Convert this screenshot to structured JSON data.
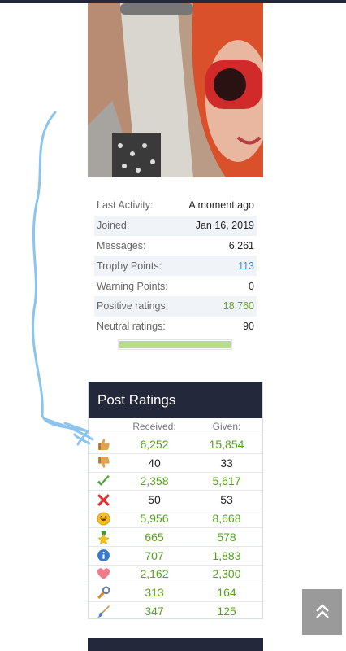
{
  "stats": [
    {
      "label": "Last Activity:",
      "value": "A moment ago",
      "style": "normal"
    },
    {
      "label": "Joined:",
      "value": "Jan 16, 2019",
      "style": "normal"
    },
    {
      "label": "Messages:",
      "value": "6,261",
      "style": "normal"
    },
    {
      "label": "Trophy Points:",
      "value": "113",
      "style": "blue"
    },
    {
      "label": "Warning Points:",
      "value": "0",
      "style": "normal"
    },
    {
      "label": "Positive ratings:",
      "value": "18,760",
      "style": "green"
    },
    {
      "label": "Neutral ratings:",
      "value": "90",
      "style": "normal"
    }
  ],
  "ratings": {
    "title": "Post Ratings",
    "received_label": "Received:",
    "given_label": "Given:",
    "rows": [
      {
        "icon": "like-icon",
        "received": "6,252",
        "given": "15,854",
        "tone": "green"
      },
      {
        "icon": "dislike-icon",
        "received": "40",
        "given": "33",
        "tone": "dark"
      },
      {
        "icon": "agree-icon",
        "received": "2,358",
        "given": "5,617",
        "tone": "green"
      },
      {
        "icon": "disagree-icon",
        "received": "50",
        "given": "53",
        "tone": "dark"
      },
      {
        "icon": "funny-icon",
        "received": "5,956",
        "given": "8,668",
        "tone": "green"
      },
      {
        "icon": "winner-icon",
        "received": "665",
        "given": "578",
        "tone": "green"
      },
      {
        "icon": "informative-icon",
        "received": "707",
        "given": "1,883",
        "tone": "green"
      },
      {
        "icon": "love-icon",
        "received": "2,162",
        "given": "2,300",
        "tone": "green"
      },
      {
        "icon": "useful-icon",
        "received": "313",
        "given": "164",
        "tone": "green"
      },
      {
        "icon": "creative-icon",
        "received": "347",
        "given": "125",
        "tone": "green"
      }
    ]
  },
  "scroll_top": {
    "icon": "double-chevron-up-icon",
    "glyph": "⌃"
  },
  "colors": {
    "header": "#23283a",
    "green": "#56a11c",
    "blue": "#3d8fd6",
    "ratio_fill": "#b6dc8c",
    "annotation": "#8cc4f0"
  }
}
